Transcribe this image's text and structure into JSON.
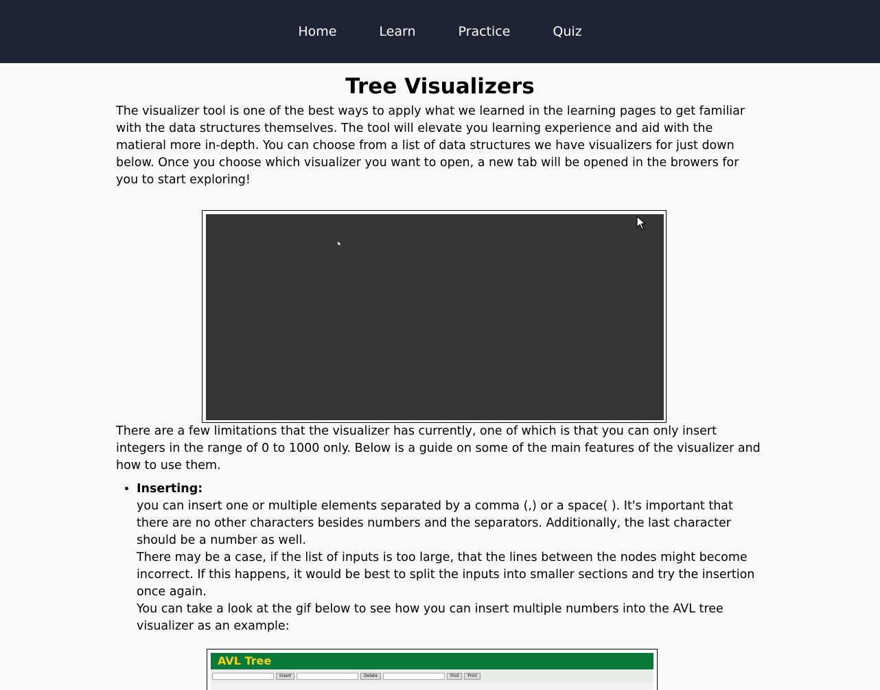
{
  "nav": {
    "items": [
      {
        "label": "Home"
      },
      {
        "label": "Learn"
      },
      {
        "label": "Practice"
      },
      {
        "label": "Quiz"
      }
    ]
  },
  "page": {
    "title": "Tree Visualizers",
    "intro": "The visualizer tool is one of the best ways to apply what we learned in the learning pages to get familiar with the data structures themselves. The tool will elevate you learning experience and aid with the matieral more in-depth. You can choose from a list of data structures we have visualizers for just down below. Once you choose which visualizer you want to open, a new tab will be opened in the browers for you to start exploring!",
    "limitations": "There are a few limitations that the visualizer has currently, one of which is that you can only insert integers in the range of 0 to 1000 only. Below is a guide on some of the main features of the visualizer and how to use them."
  },
  "features": {
    "inserting": {
      "title": "Inserting:",
      "line1": "you can insert one or multiple elements separated by a comma (,) or a space( ). It's important that there are no other characters besides numbers and the separators. Additionally, the last character should be a number as well.",
      "line2": "There may be a case, if the list of inputs is too large, that the lines between the nodes might become incorrect. If this happens, it would be best to split the inputs into smaller sections and try the insertion once again.",
      "line3": "You can take a look at the gif below to see how you can insert multiple numbers into the AVL tree visualizer as an example:"
    }
  },
  "gif": {
    "title": "AVL Tree",
    "insert_label": "Insert",
    "delete_label": "Delete",
    "find_label": "Find",
    "print_label": "Print"
  },
  "colors": {
    "navbar": "#1e2433",
    "background": "#f8fafc",
    "visualizer": "#363636",
    "gif_header": "#0a7a3a",
    "gif_title": "#f5d020"
  }
}
